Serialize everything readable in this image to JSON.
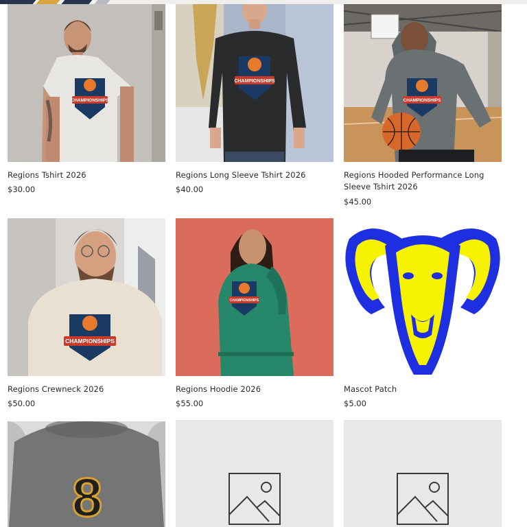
{
  "products": [
    {
      "name": "Regions Tshirt 2026",
      "price": "$30.00",
      "image_label": "CHAMPIONSHIPS"
    },
    {
      "name": "Regions Long Sleeve Tshirt 2026",
      "price": "$40.00",
      "image_label": "CHAMPIONSHIPS"
    },
    {
      "name": "Regions Hooded Performance Long Sleeve Tshirt 2026",
      "price": "$45.00",
      "image_label": "CHAMPIONSHIPS"
    },
    {
      "name": "Regions Crewneck 2026",
      "price": "$50.00",
      "image_label": "CHAMPIONSHIPS"
    },
    {
      "name": "Regions Hoodie 2026",
      "price": "$55.00",
      "image_label": "CHAMPIONSHIPS"
    },
    {
      "name": "Mascot Patch",
      "price": "$5.00",
      "image_label": ""
    },
    {
      "jersey_number": "8"
    },
    {
      "image_placeholder_icon": "image-placeholder-icon"
    },
    {
      "image_placeholder_icon": "image-placeholder-icon"
    }
  ],
  "colors": {
    "placeholder_bg": "#e9e7e8",
    "mascot_blue": "#1d2fe0",
    "mascot_yellow": "#f7f200",
    "text": "#2a2a2a"
  }
}
